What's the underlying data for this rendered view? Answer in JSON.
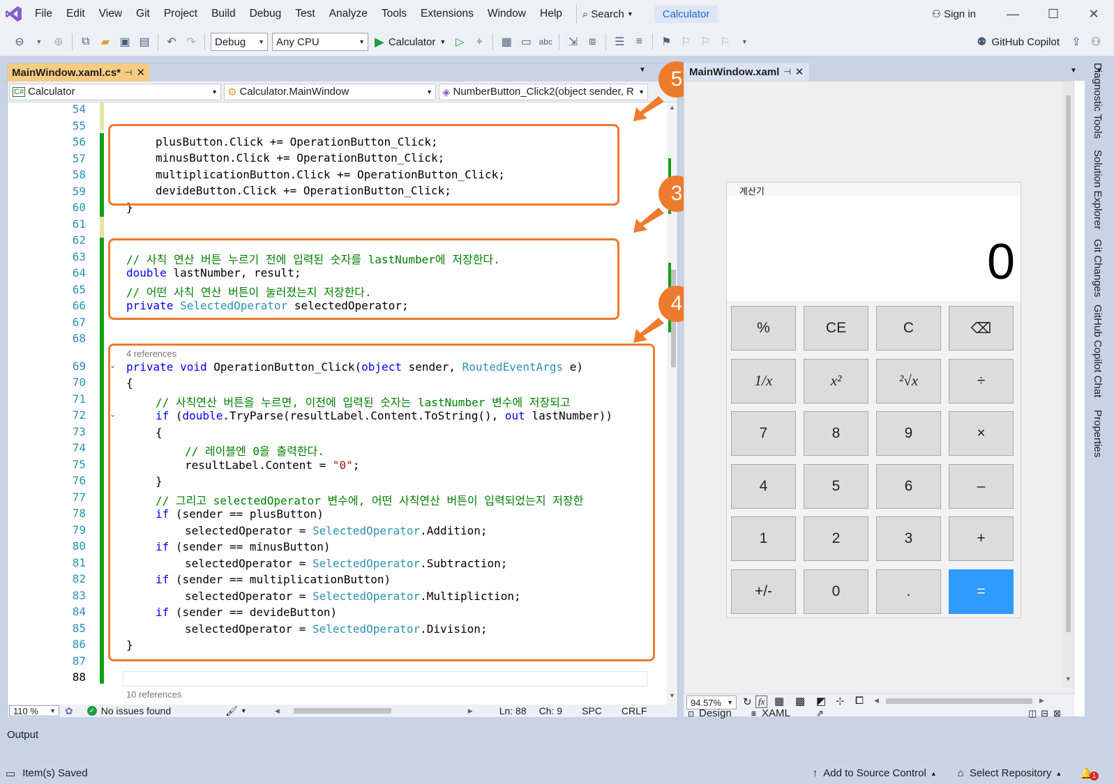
{
  "menu": {
    "items": [
      "File",
      "Edit",
      "View",
      "Git",
      "Project",
      "Build",
      "Debug",
      "Test",
      "Analyze",
      "Tools",
      "Extensions",
      "Window",
      "Help"
    ],
    "search_label": "Search",
    "app_title": "Calculator",
    "sign_in": "Sign in"
  },
  "toolbar": {
    "config": "Debug",
    "platform": "Any CPU",
    "run_label": "Calculator",
    "copilot": "GitHub Copilot"
  },
  "editor": {
    "tab_label": "MainWindow.xaml.cs*",
    "nav": {
      "project": "Calculator",
      "class": "Calculator.MainWindow",
      "member": "NumberButton_Click2(object sender, R"
    },
    "line_numbers": [
      "54",
      "55",
      "56",
      "57",
      "58",
      "59",
      "60",
      "61",
      "62",
      "63",
      "64",
      "65",
      "66",
      "67",
      "68",
      "69",
      "70",
      "71",
      "72",
      "73",
      "74",
      "75",
      "76",
      "77",
      "78",
      "79",
      "80",
      "81",
      "82",
      "83",
      "84",
      "85",
      "86",
      "87",
      "88"
    ],
    "refs_top": "4 references",
    "refs_bottom": "10 references",
    "code": {
      "l56": "plusButton.Click += OperationButton_Click;",
      "l57": "minusButton.Click += OperationButton_Click;",
      "l58": "multiplicationButton.Click += OperationButton_Click;",
      "l59": "devideButton.Click += OperationButton_Click;",
      "l60": "}",
      "l63": "// 사칙 연산 버튼 누르기 전에 입력된 숫자를 lastNumber에 저장한다.",
      "l64_kw": "double",
      "l64": " lastNumber, result;",
      "l65": "// 어떤 사칙 연산 버튼이 눌러졌는지 저장한다.",
      "l66_kw": "private",
      "l66_ty": " SelectedOperator",
      "l66": " selectedOperator;",
      "l69_kw1": "private void",
      "l69_a": " OperationButton_Click(",
      "l69_kw2": "object",
      "l69_b": " sender, ",
      "l69_ty": "RoutedEventArgs",
      "l69_c": " e)",
      "l70": "{",
      "l71": "// 사칙연산 버튼을 누르면, 이전에 입력된 숫자는 lastNumber 변수에 저장되고",
      "l72_kw": "if",
      "l72_a": " (",
      "l72_kw2": "double",
      "l72_b": ".TryParse(resultLabel.Content.ToString(), ",
      "l72_kw3": "out",
      "l72_c": " lastNumber))",
      "l73": "{",
      "l74": "// 레이블엔 0을 출력한다.",
      "l75_a": "resultLabel.Content = ",
      "l75_st": "\"0\"",
      "l75_b": ";",
      "l76": "}",
      "l77": "// 그리고 selectedOperator 변수에, 어떤 사칙연산 버튼이 입력되었는지 저장한",
      "if": "if",
      "l78": " (sender == plusButton)",
      "l80": " (sender == minusButton)",
      "l82": " (sender == multiplicationButton)",
      "l84": " (sender == devideButton)",
      "assign": "selectedOperator = ",
      "enum": "SelectedOperator",
      "l79": ".Addition;",
      "l81": ".Subtraction;",
      "l83": ".Multipliction;",
      "l85": ".Division;",
      "l86": "}"
    },
    "zoom": "110 %",
    "issues": "No issues found",
    "ln": "Ln: 88",
    "ch": "Ch: 9",
    "spc": "SPC",
    "crlf": "CRLF"
  },
  "callouts": [
    "5",
    "3",
    "4"
  ],
  "designer": {
    "tab_label": "MainWindow.xaml",
    "window_title": "계산기",
    "display": "0",
    "buttons": [
      "%",
      "CE",
      "C",
      "⌫",
      "1/x",
      "x²",
      "²√x",
      "÷",
      "7",
      "8",
      "9",
      "×",
      "4",
      "5",
      "6",
      "–",
      "1",
      "2",
      "3",
      "+",
      "+/-",
      "0",
      ".",
      "="
    ],
    "zoom": "94.57%",
    "design_tab": "Design",
    "xaml_tab": "XAML",
    "fx": "fx"
  },
  "right_rail": [
    "Diagnostic Tools",
    "Solution Explorer",
    "Git Changes",
    "GitHub Copilot Chat",
    "Properties"
  ],
  "output_label": "Output",
  "status": {
    "saved": "Item(s) Saved",
    "source_control": "Add to Source Control",
    "repo": "Select Repository",
    "notif_count": "1"
  },
  "colors": {
    "accent": "#1e6bd1",
    "highlight": "#f0782a",
    "equals": "#2f9bff",
    "tab_active": "#f5cc84",
    "changed_bar": "#10a010"
  }
}
